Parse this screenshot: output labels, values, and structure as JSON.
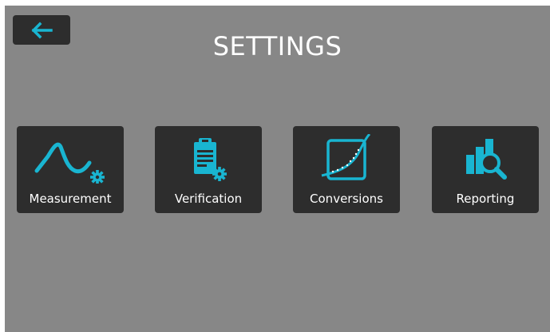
{
  "header": {
    "title": "SETTINGS",
    "back_icon": "arrow-left-icon"
  },
  "tiles": [
    {
      "label": "Measurement",
      "icon": "measurement-curve-gear-icon"
    },
    {
      "label": "Verification",
      "icon": "clipboard-gear-icon"
    },
    {
      "label": "Conversions",
      "icon": "conversion-graph-icon"
    },
    {
      "label": "Reporting",
      "icon": "bar-chart-magnifier-icon"
    }
  ],
  "colors": {
    "background": "#878787",
    "tile": "#2d2d2d",
    "accent": "#19b5d1",
    "text": "#ffffff"
  }
}
